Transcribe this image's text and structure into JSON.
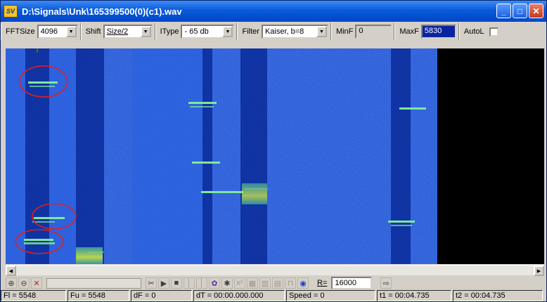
{
  "window": {
    "title": "D:\\Signals\\Unk\\165399500(0)(c1).wav",
    "icon_text": "SV",
    "buttons": [
      "minimize-icon",
      "maximize-icon",
      "close-icon"
    ]
  },
  "toolbar": {
    "fftsize_label": "FFTSize",
    "fftsize_value": "4096",
    "shift_label": "Shift",
    "shift_value": "Size/2",
    "itype_label": "IType",
    "itype_value": "- 65 db",
    "filter_label": "Filter",
    "filter_value": "Kaiser, b=8",
    "minf_label": "MinF",
    "minf_value": "0",
    "maxf_label": "MaxF",
    "maxf_value": "5830",
    "autol_label": "AutoL"
  },
  "controls": {
    "r_label": "R=",
    "r_value": "16000"
  },
  "status": {
    "fl": "Fl = 5548",
    "fu": "Fu = 5548",
    "df": "dF = 0",
    "dt": "dT = 00:00.000.000",
    "speed": "Speed = 0",
    "t1": "t1 = 00:04.735",
    "t2": "t2 = 00:04.735"
  },
  "colors": {
    "background": "#1f4fd0",
    "dark_band": "#0b2b9a",
    "signal": "#7fe89a",
    "annotation": "#e02020",
    "blank": "#000000"
  }
}
